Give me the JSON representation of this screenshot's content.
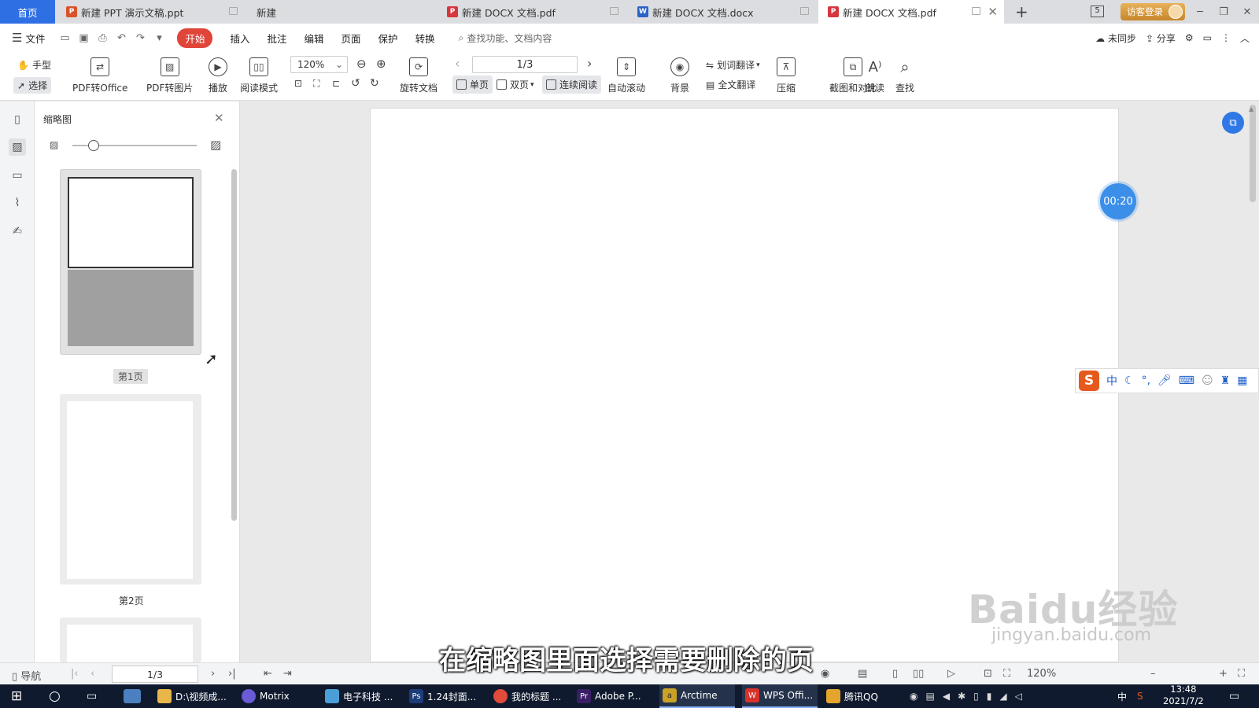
{
  "tabs": {
    "home": "首页",
    "items": [
      {
        "label": "新建 PPT 演示文稿.ppt",
        "icon": "ppt-icon",
        "color": "#d9532c"
      },
      {
        "label": "新建",
        "icon": "",
        "color": ""
      },
      {
        "label": "新建 DOCX 文档.pdf",
        "icon": "pdf-icon",
        "color": "#d6363e"
      },
      {
        "label": "新建 DOCX 文档.docx",
        "icon": "word-icon",
        "color": "#2b62c6"
      },
      {
        "label": "新建 DOCX 文档.pdf",
        "icon": "pdf-icon",
        "color": "#d6363e"
      }
    ],
    "add": "+",
    "badge": "5",
    "login": "访客登录"
  },
  "menu": {
    "file": "文件",
    "items": [
      "开始",
      "插入",
      "批注",
      "编辑",
      "页面",
      "保护",
      "转换"
    ],
    "search_placeholder": "查找功能、文档内容",
    "unsynced": "未同步",
    "share": "分享"
  },
  "toolbar": {
    "hand": "手型",
    "select": "选择",
    "pdf_to_office": "PDF转Office",
    "pdf_to_image": "PDF转图片",
    "play": "播放",
    "read_mode": "阅读模式",
    "zoom": "120%",
    "rotate_doc": "旋转文档",
    "page_indicator": "1/3",
    "single_page": "单页",
    "double_page": "双页",
    "continuous": "连续阅读",
    "auto_scroll": "自动滚动",
    "background": "背景",
    "word_translate": "划词翻译",
    "full_translate": "全文翻译",
    "compress": "压缩",
    "screenshot_compare": "截图和对比",
    "read_aloud": "朗读",
    "find": "查找"
  },
  "thumbnails": {
    "title": "缩略图",
    "pages": [
      "第1页",
      "第2页"
    ]
  },
  "overlay": {
    "timer": "00:20",
    "subtitle": "在缩略图里面选择需要删除的页",
    "watermark": "Baidu经验",
    "watermark_sub": "jingyan.baidu.com",
    "ime_lang": "中"
  },
  "statusbar": {
    "nav": "导航",
    "page": "1/3",
    "zoom": "120%"
  },
  "taskbar": {
    "items": [
      {
        "label": "D:\\视频成...",
        "color": "#e8b64a"
      },
      {
        "label": "Motrix",
        "color": "#6a5bd6"
      },
      {
        "label": "电子科技 ...",
        "color": "#4b9fd8"
      },
      {
        "label": "1.24封面...",
        "color": "#1c3d7a"
      },
      {
        "label": "我的标题 ...",
        "color": "#e04b3a"
      },
      {
        "label": "Adobe P...",
        "color": "#3a1f66"
      },
      {
        "label": "Arctime",
        "color": "#c9a227"
      },
      {
        "label": "WPS Offi...",
        "color": "#d8322a"
      },
      {
        "label": "腾讯QQ",
        "color": "#e3a52c"
      }
    ],
    "tray_lang": "中",
    "time": "13:48",
    "date": "2021/7/2"
  }
}
